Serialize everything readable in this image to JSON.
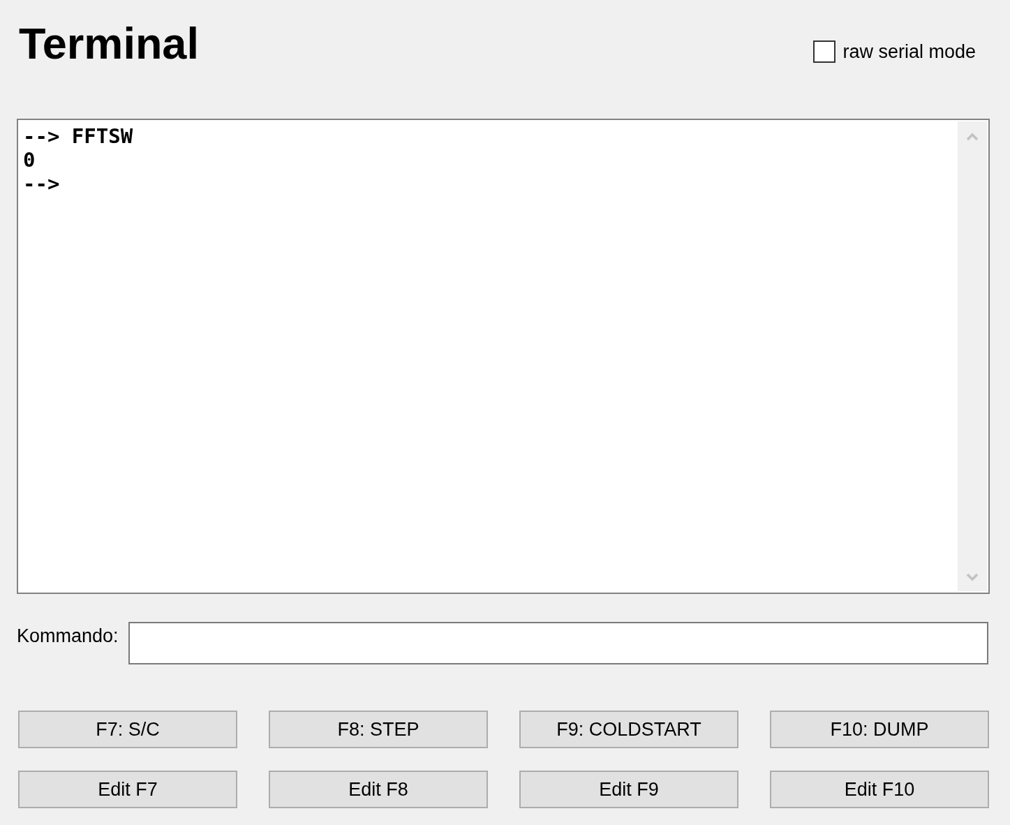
{
  "title": "Terminal",
  "raw_serial_mode": {
    "label": "raw serial mode",
    "checked": false
  },
  "terminal": {
    "lines": [
      "--> FFTSW",
      "0",
      "-->"
    ]
  },
  "command": {
    "label": "Kommando:"
  },
  "function_keys": [
    {
      "label": "F7: S/C"
    },
    {
      "label": "F8: STEP"
    },
    {
      "label": "F9: COLDSTART"
    },
    {
      "label": "F10: DUMP"
    }
  ],
  "edit_buttons": [
    {
      "label": "Edit F7"
    },
    {
      "label": "Edit F8"
    },
    {
      "label": "Edit F9"
    },
    {
      "label": "Edit F10"
    }
  ]
}
